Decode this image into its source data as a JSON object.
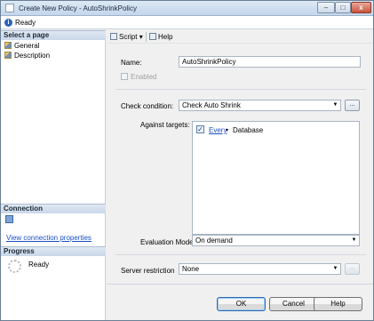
{
  "window": {
    "title": "Create New Policy - AutoShrinkPolicy",
    "minimize_glyph": "–",
    "maximize_glyph": "□",
    "close_glyph": "x"
  },
  "status": {
    "text": "Ready"
  },
  "sidebar": {
    "select_page_header": "Select a page",
    "pages": [
      {
        "label": "General"
      },
      {
        "label": "Description"
      }
    ],
    "connection_header": "Connection",
    "connection_link": "View connection properties",
    "progress_header": "Progress",
    "progress_status": "Ready"
  },
  "toolbar": {
    "script_label": "Script",
    "dropdown_glyph": "▾",
    "help_label": "Help"
  },
  "form": {
    "name_label": "Name:",
    "name_value": "AutoShrinkPolicy",
    "enabled_label": "Enabled",
    "check_condition_label": "Check condition:",
    "check_condition_value": "Check Auto Shrink",
    "against_targets_label": "Against targets:",
    "target": {
      "checked_glyph": "✓",
      "every_link": "Every",
      "arrow_glyph": "▾",
      "target_name": "Database"
    },
    "evaluation_mode_label": "Evaluation Mode:",
    "evaluation_mode_value": "On demand",
    "server_restriction_label": "Server restriction",
    "server_restriction_value": "None",
    "ellipsis_label": "...",
    "combo_arrow": "▼"
  },
  "footer": {
    "ok_label": "OK",
    "cancel_label": "Cancel",
    "help_label": "Help"
  }
}
